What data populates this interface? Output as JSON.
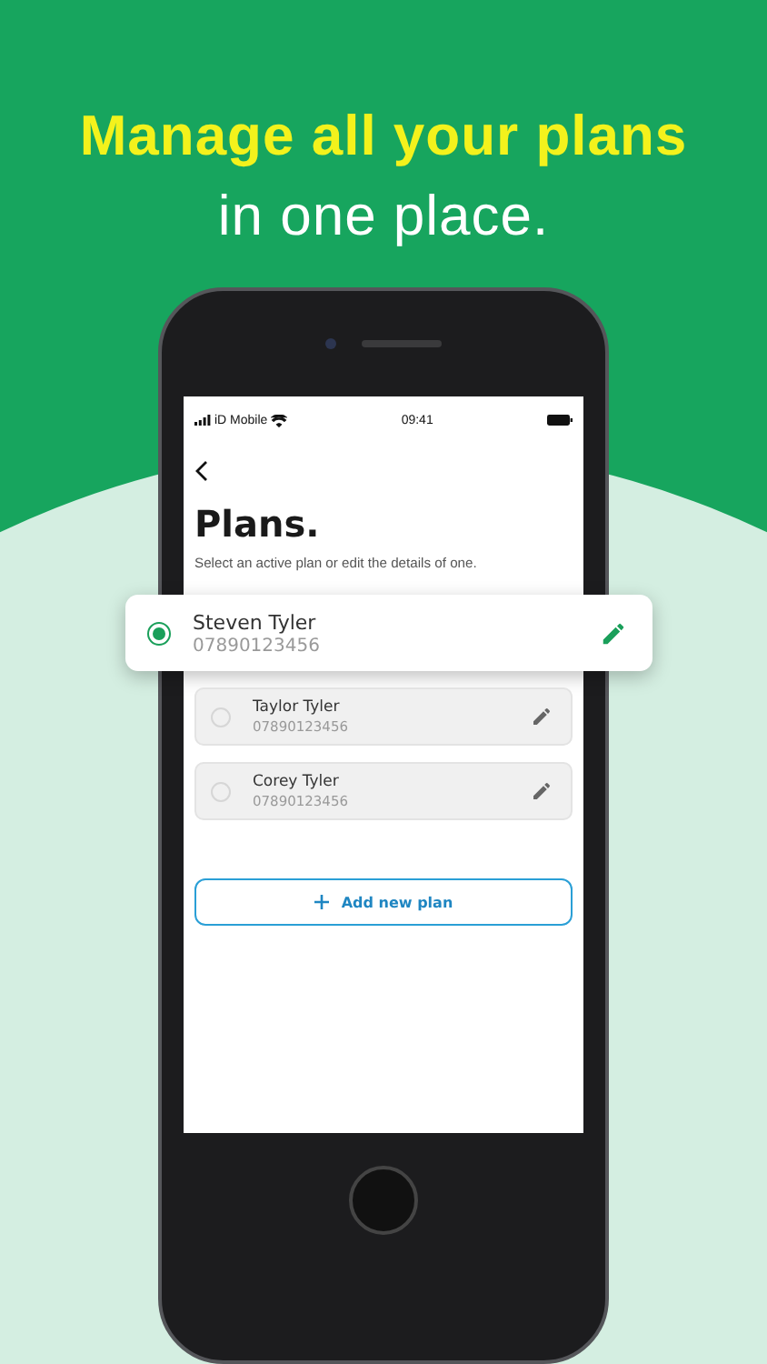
{
  "headline": {
    "highlight": "Manage all your plans",
    "rest": "in one place."
  },
  "status_bar": {
    "carrier": "iD Mobile",
    "time": "09:41"
  },
  "title": "Plans.",
  "subtitle": "Select an active plan or edit the details of one.",
  "plans": [
    {
      "name": "Steven Tyler",
      "phone": "07890123456",
      "selected": true
    },
    {
      "name": "Taylor Tyler",
      "phone": "07890123456",
      "selected": false
    },
    {
      "name": "Corey Tyler",
      "phone": "07890123456",
      "selected": false
    }
  ],
  "add_button": "Add new plan"
}
